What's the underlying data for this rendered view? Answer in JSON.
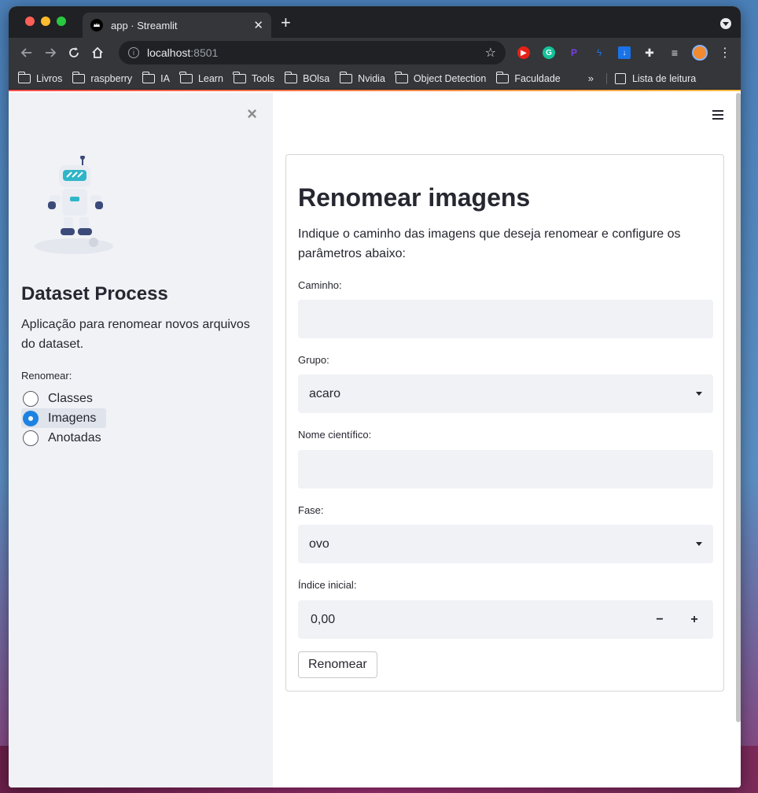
{
  "browser": {
    "tab_title": "app · Streamlit",
    "tab_close": "✕",
    "new_tab": "+",
    "url_host": "localhost",
    "url_port": ":8501",
    "bookmarks": [
      "Livros",
      "raspberry",
      "IA",
      "Learn",
      "Tools",
      "BOlsa",
      "Nvidia",
      "Object Detection",
      "Faculdade"
    ],
    "bookmarks_more": "»",
    "reading_list": "Lista de leitura"
  },
  "sidebar": {
    "close": "×",
    "title": "Dataset Process",
    "description": "Aplicação para renomear novos arquivos do dataset.",
    "radio_label": "Renomear:",
    "radio_options": [
      "Classes",
      "Imagens",
      "Anotadas"
    ],
    "radio_selected": "Imagens"
  },
  "main": {
    "title": "Renomear imagens",
    "description": "Indique o caminho das imagens que deseja renomear e configure os parâmetros abaixo:",
    "fields": {
      "caminho_label": "Caminho:",
      "caminho_value": "",
      "grupo_label": "Grupo:",
      "grupo_value": "acaro",
      "nome_label": "Nome científico:",
      "nome_value": "",
      "fase_label": "Fase:",
      "fase_value": "ovo",
      "indice_label": "Índice inicial:",
      "indice_value": "0,00",
      "minus": "−",
      "plus": "+"
    },
    "submit_label": "Renomear"
  },
  "colors": {
    "accent": "#1c83e1",
    "sidebar_bg": "#f0f2f6",
    "text": "#262730"
  }
}
